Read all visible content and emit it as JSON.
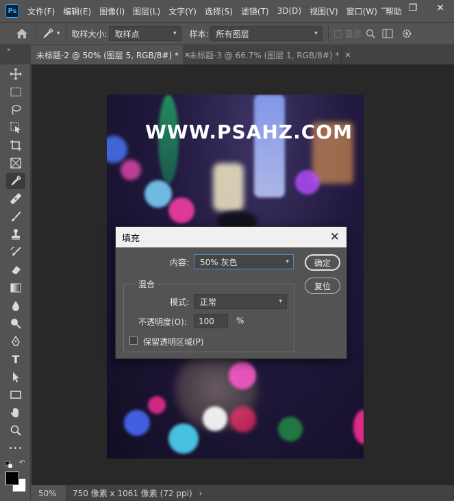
{
  "app": {
    "logo": "Ps"
  },
  "menu": [
    "文件(F)",
    "编辑(E)",
    "图像(I)",
    "图层(L)",
    "文字(Y)",
    "选择(S)",
    "滤镜(T)",
    "3D(D)",
    "视图(V)",
    "窗口(W)",
    "帮助"
  ],
  "window_controls": {
    "minimize": "—",
    "restore": "❐",
    "close": "✕"
  },
  "options": {
    "sample_size_label": "取样大小:",
    "sample_size_value": "取样点",
    "sample_label": "样本:",
    "sample_value": "所有图层",
    "show_ring_label": "显示"
  },
  "tabs": [
    {
      "label": "未标题-2 @ 50% (图层 5, RGB/8#) *"
    },
    {
      "label": "未标题-3 @ 66.7% (图层 1, RGB/8#) *"
    }
  ],
  "tools": [
    "move-icon",
    "marquee-icon",
    "lasso-icon",
    "object-select-icon",
    "crop-icon",
    "frame-icon",
    "eyedropper-icon",
    "healing-icon",
    "brush-icon",
    "stamp-icon",
    "history-brush-icon",
    "eraser-icon",
    "gradient-icon",
    "blur-icon",
    "dodge-icon",
    "pen-icon",
    "type-icon",
    "path-select-icon",
    "rectangle-icon",
    "hand-icon",
    "zoom-icon",
    "more-icon"
  ],
  "tool_type_glyph": "T",
  "tool_more_glyph": "•••",
  "document": {
    "watermark": "WWW.PSAHZ.COM"
  },
  "status": {
    "zoom": "50%",
    "doc_size": "750 像素 x 1061 像素 (72 ppi)",
    "arrow": "›"
  },
  "dialog": {
    "title": "填充",
    "content_label": "内容:",
    "content_value": "50% 灰色",
    "ok": "确定",
    "reset": "复位",
    "blend_group": "混合",
    "mode_label": "模式:",
    "mode_value": "正常",
    "opacity_label": "不透明度(O):",
    "opacity_value": "100",
    "opacity_unit": "%",
    "preserve_label": "保留透明区域(P)",
    "preserve_checked": false
  },
  "colors": {
    "foreground": "#000000",
    "background": "#ffffff",
    "accent": "#31a8ff"
  }
}
